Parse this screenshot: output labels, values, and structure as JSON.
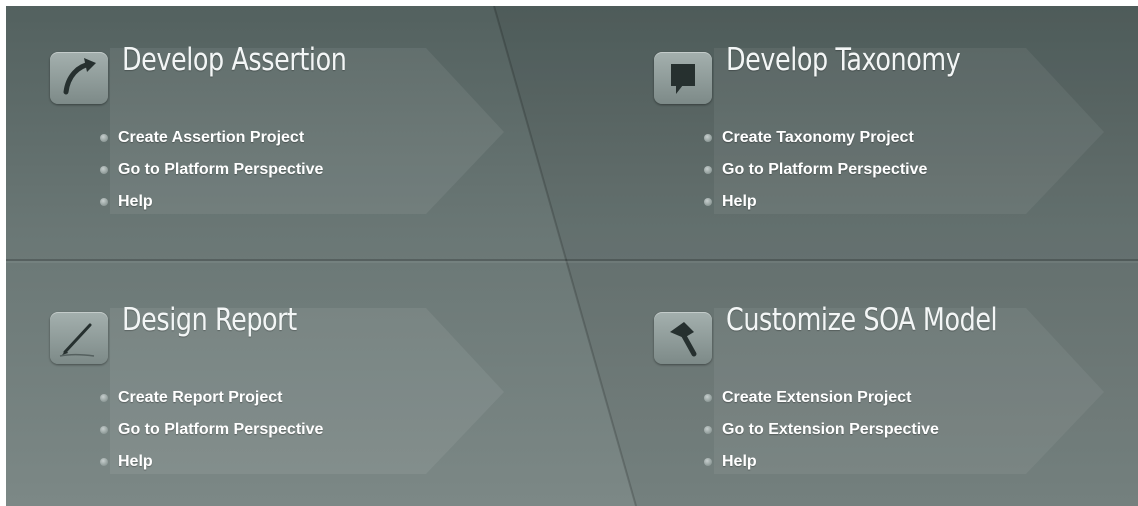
{
  "panels": [
    {
      "title": "Develop Assertion",
      "icon": "curved-arrow-icon",
      "links": [
        "Create Assertion Project",
        "Go to Platform Perspective",
        "Help"
      ]
    },
    {
      "title": "Develop Taxonomy",
      "icon": "speech-bubble-icon",
      "links": [
        "Create Taxonomy Project",
        "Go to Platform Perspective",
        "Help"
      ]
    },
    {
      "title": "Design Report",
      "icon": "pen-icon",
      "links": [
        "Create Report Project",
        "Go to Platform Perspective",
        "Help"
      ]
    },
    {
      "title": "Customize SOA Model",
      "icon": "hammer-icon",
      "links": [
        "Create Extension Project",
        "Go to Extension Perspective",
        "Help"
      ]
    }
  ],
  "colors": {
    "background_top": "#53615f",
    "background_bottom": "#7c8886",
    "text": "#ffffff"
  }
}
